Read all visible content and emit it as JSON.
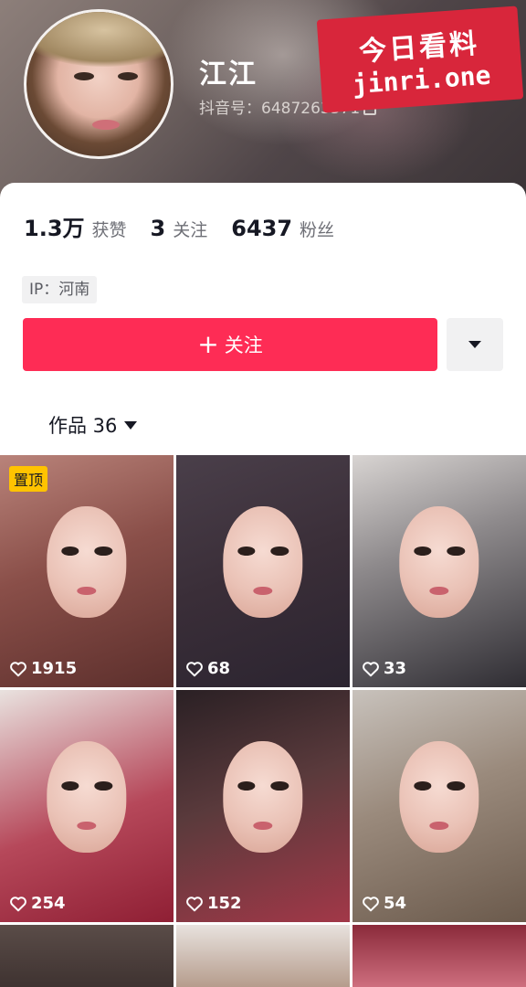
{
  "profile": {
    "name": "江江",
    "douyin_id": "抖音号：6487263371",
    "ip": "IP：河南"
  },
  "watermark": {
    "line1": "今日看料",
    "line2": "jinri.one"
  },
  "stats": [
    {
      "value": "1.3万",
      "label": "获赞"
    },
    {
      "value": "3",
      "label": "关注"
    },
    {
      "value": "6437",
      "label": "粉丝"
    }
  ],
  "actions": {
    "follow_plus": "+",
    "follow_label": "关注"
  },
  "works_tab": {
    "label": "作品 36"
  },
  "videos": [
    {
      "likes": "1915",
      "pinned": "置顶"
    },
    {
      "likes": "68"
    },
    {
      "likes": "33"
    },
    {
      "likes": "254"
    },
    {
      "likes": "152"
    },
    {
      "likes": "54"
    }
  ],
  "colors": {
    "accent": "#fe2c55",
    "pin_badge": "#ffc300",
    "watermark": "#d8263b"
  },
  "icons": {
    "more": "triangle-down-icon",
    "copy": "copy-icon",
    "heart": "heart-outline-icon"
  }
}
